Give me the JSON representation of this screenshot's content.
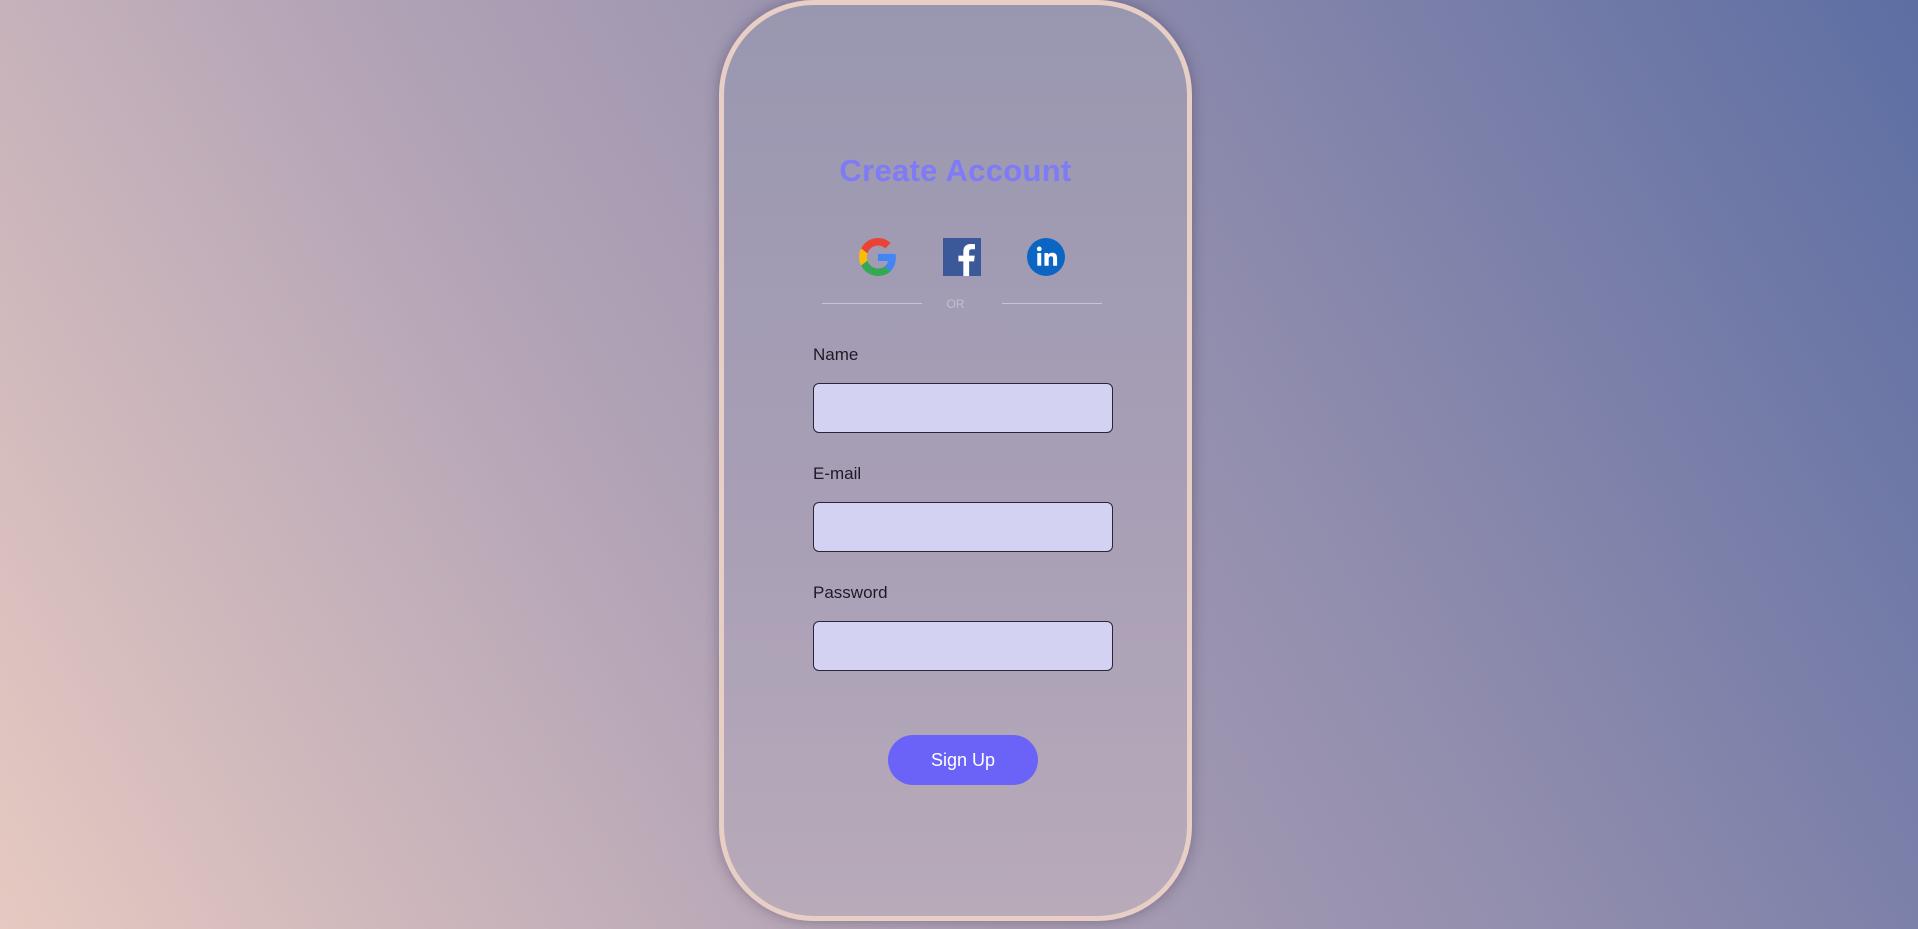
{
  "form": {
    "title": "Create Account",
    "divider_text": "OR",
    "social": [
      {
        "icon": "google-icon"
      },
      {
        "icon": "facebook-icon"
      },
      {
        "icon": "linkedin-icon"
      }
    ],
    "fields": {
      "name": {
        "label": "Name",
        "value": ""
      },
      "email": {
        "label": "E-mail",
        "value": ""
      },
      "password": {
        "label": "Password",
        "value": ""
      }
    },
    "submit_label": "Sign Up"
  },
  "colors": {
    "title": "#7f7af6",
    "button": "#6b63f8",
    "input_bg": "#d4d2f2",
    "card_border": "#e8cfc6",
    "facebook": "#3b5998",
    "linkedin": "#0a66c2"
  }
}
